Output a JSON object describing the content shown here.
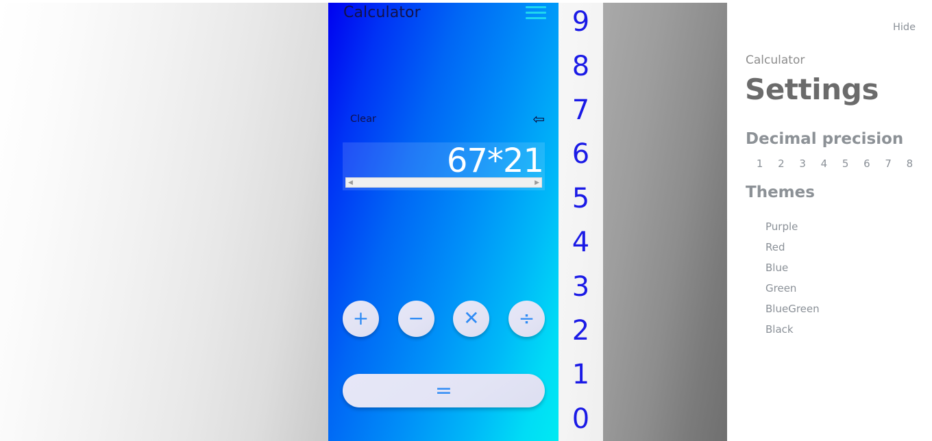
{
  "calculator": {
    "title": "Calculator",
    "menu_icon": "hamburger-menu-icon",
    "clear_label": "Clear",
    "backspace_icon": "⇦",
    "display_value": "67*21",
    "scroll_left_icon": "◀",
    "scroll_right_icon": "▶",
    "digits": [
      "9",
      "8",
      "7",
      "6",
      "5",
      "4",
      "3",
      "2",
      "1",
      "0"
    ],
    "operators": [
      {
        "name": "plus",
        "symbol": "+"
      },
      {
        "name": "minus",
        "symbol": "−"
      },
      {
        "name": "multiply",
        "symbol": "✕"
      },
      {
        "name": "divide",
        "symbol": "÷"
      }
    ],
    "equals_symbol": "=",
    "colors": {
      "gradient_start": "#0000f0",
      "gradient_end": "#00eaf2",
      "title_text": "#12124a",
      "menu_icon": "#1fd6f0",
      "digit_text": "#1a1ae6",
      "button_face": "#e3e5f5",
      "button_symbol": "#2e8bf5",
      "display_text": "#ffffff"
    }
  },
  "settings": {
    "hide_label": "Hide",
    "eyebrow": "Calculator",
    "title": "Settings",
    "precision": {
      "heading": "Decimal precision",
      "options": [
        "1",
        "2",
        "3",
        "4",
        "5",
        "6",
        "7",
        "8"
      ]
    },
    "themes": {
      "heading": "Themes",
      "options": [
        "Purple",
        "Red",
        "Blue",
        "Green",
        "BlueGreen",
        "Black"
      ]
    },
    "colors": {
      "panel_bg": "#ffffff",
      "heading_text": "#8c9196",
      "title_text": "#6b6b6b",
      "option_text": "#8a9097"
    }
  }
}
